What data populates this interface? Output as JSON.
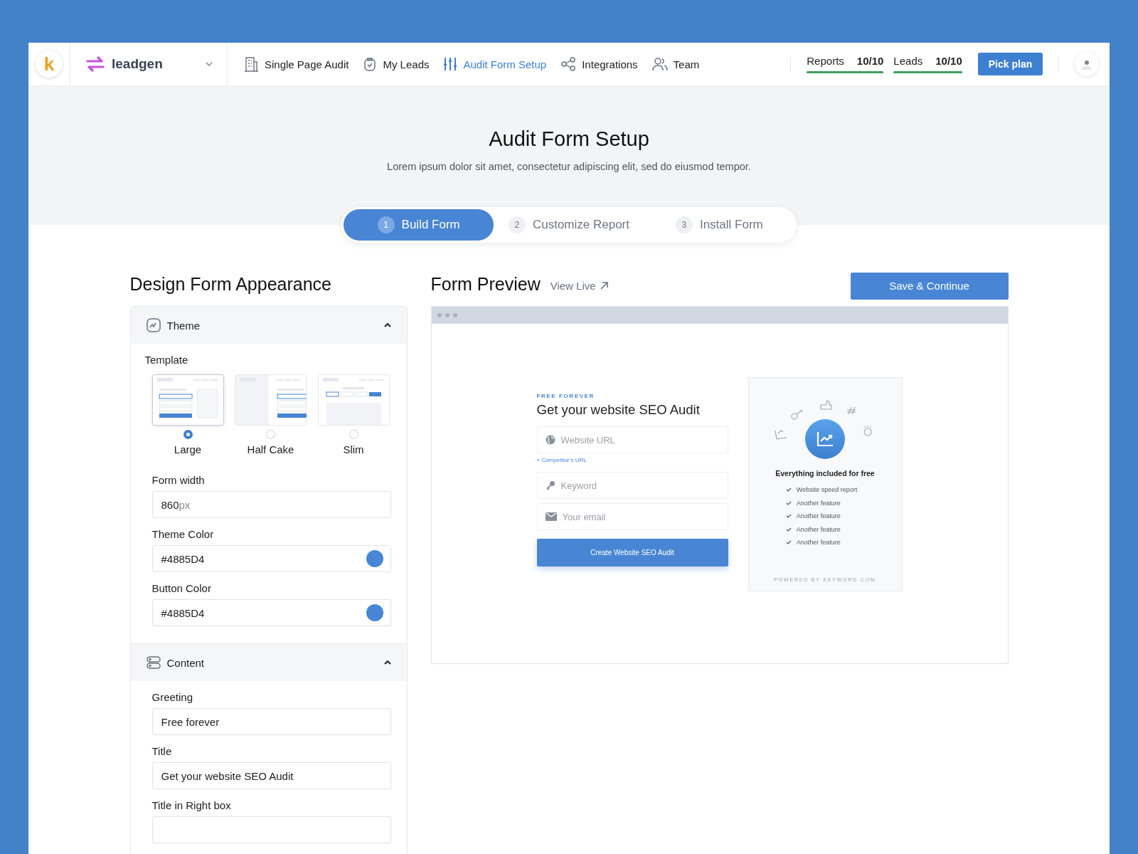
{
  "brand": {
    "logo_letter": "k",
    "name": "leadgen"
  },
  "nav": [
    {
      "label": "Single Page Audit",
      "selected": false
    },
    {
      "label": "My Leads",
      "selected": false
    },
    {
      "label": "Audit Form Setup",
      "selected": true
    },
    {
      "label": "Integrations",
      "selected": false
    },
    {
      "label": "Team",
      "selected": false
    }
  ],
  "usage": [
    {
      "label": "Reports",
      "value": "10/10",
      "level": 1
    },
    {
      "label": "Leads",
      "value": "10/10",
      "level": 1
    }
  ],
  "plan_button": "Pick plan",
  "page": {
    "title": "Audit Form Setup",
    "subtitle": "Lorem ipsum dolor sit amet, consectetur adipiscing elit, sed do eiusmod tempor."
  },
  "steps": [
    {
      "number": "1",
      "label": "Build Form",
      "selected": true
    },
    {
      "number": "2",
      "label": "Customize Report",
      "selected": false
    },
    {
      "number": "3",
      "label": "Install Form",
      "selected": false
    }
  ],
  "design": {
    "heading": "Design Form Appearance",
    "sections": [
      {
        "title": "Theme",
        "expanded": true,
        "template_label": "Template",
        "templates": [
          {
            "label": "Large",
            "kind": "large",
            "selected": true
          },
          {
            "label": "Half Cake",
            "kind": "half",
            "selected": false
          },
          {
            "label": "Slim",
            "kind": "slim",
            "selected": false
          }
        ],
        "fields": [
          {
            "label": "Form width",
            "kind": "number",
            "value": "860",
            "suffix": "px"
          },
          {
            "label": "Theme Color",
            "kind": "color",
            "value": "#4885D4",
            "color": "#4885d4"
          },
          {
            "label": "Button Color",
            "kind": "color",
            "value": "#4885D4",
            "color": "#4885d4"
          }
        ]
      },
      {
        "title": "Content",
        "expanded": true,
        "fields": [
          {
            "label": "Greeting",
            "kind": "text",
            "value": "Free forever"
          },
          {
            "label": "Title",
            "kind": "text",
            "value": "Get your website SEO Audit"
          },
          {
            "label": "Title in Right box",
            "kind": "text"
          }
        ]
      }
    ]
  },
  "preview": {
    "heading": "Form Preview",
    "view_live": "View Live",
    "save_button": "Save & Continue",
    "form": {
      "greeting": "FREE FOREVER",
      "title": "Get your website SEO Audit",
      "fields": [
        {
          "placeholder": "Website URL"
        },
        {
          "placeholder": "Keyword"
        },
        {
          "placeholder": "Your email"
        }
      ],
      "competitor_link": "+ Competitor’s URL",
      "submit": "Create Website SEO Audit"
    },
    "right_box": {
      "title": "Everything included for free",
      "features": [
        "Website speed report",
        "Another feature",
        "Another feature",
        "Another feature",
        "Another feature"
      ],
      "footer": "POWERED BY KEYWORD.COM"
    }
  }
}
